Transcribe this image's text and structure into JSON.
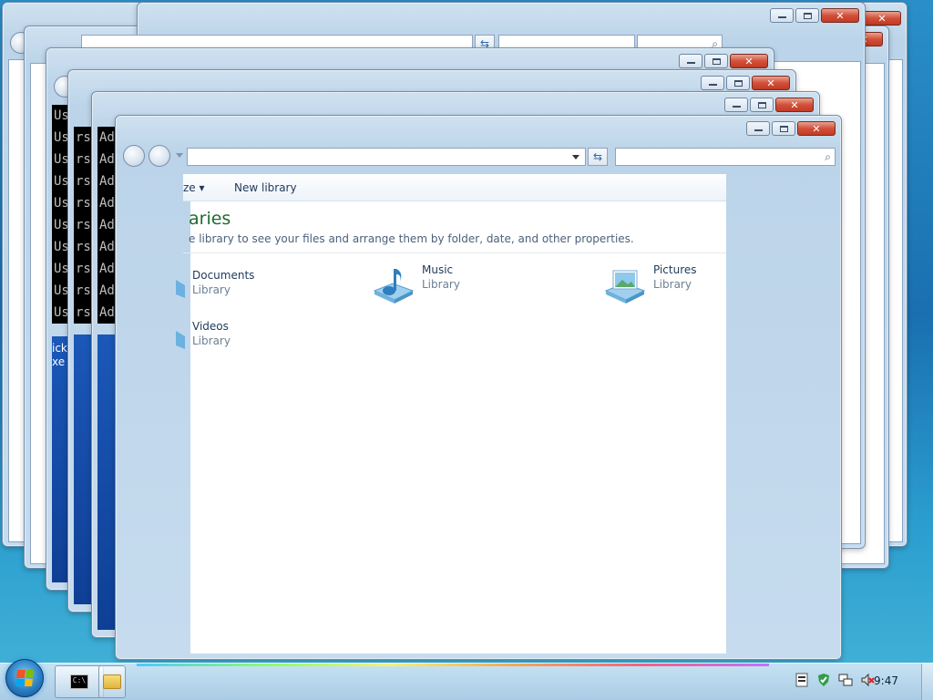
{
  "main_window": {
    "toolbar": {
      "organize_label": "ze",
      "new_library_label": "New library"
    },
    "title": "aries",
    "description": "e library to see your files and arrange them by folder, date, and other properties.",
    "libraries": [
      {
        "name": "Documents",
        "type": "Library",
        "icon": "documents-library-icon"
      },
      {
        "name": "Music",
        "type": "Library",
        "icon": "music-library-icon"
      },
      {
        "name": "Pictures",
        "type": "Library",
        "icon": "pictures-library-icon"
      },
      {
        "name": "Videos",
        "type": "Library",
        "icon": "videos-library-icon"
      }
    ]
  },
  "console_lines": {
    "col1": [
      "Us",
      "Us",
      "Us",
      "Us",
      "Us",
      "Us",
      "Us",
      "Us",
      "Us",
      "Us"
    ],
    "col2": [
      "rs",
      "rs",
      "rs",
      "rs",
      "rs",
      "rs",
      "rs",
      "rs",
      "rs"
    ],
    "col3": [
      "Ad",
      "Ad",
      "Ad",
      "Ad",
      "Ad",
      "Ad",
      "Ad",
      "Ad",
      "Ad"
    ]
  },
  "blue_panel": {
    "line1": "ick",
    "line2": "xe"
  },
  "taskbar": {
    "clock": "9:47",
    "pinned": [
      {
        "icon": "command-prompt-icon"
      },
      {
        "icon": "windows-explorer-icon"
      }
    ],
    "tray_icons": [
      "action-center-icon",
      "security-shield-icon",
      "network-icon",
      "volume-muted-icon"
    ]
  },
  "colors": {
    "desktop_blue": "#1a6fb0",
    "library_title_green": "#1e6b2e",
    "close_button_red": "#c23a24"
  }
}
